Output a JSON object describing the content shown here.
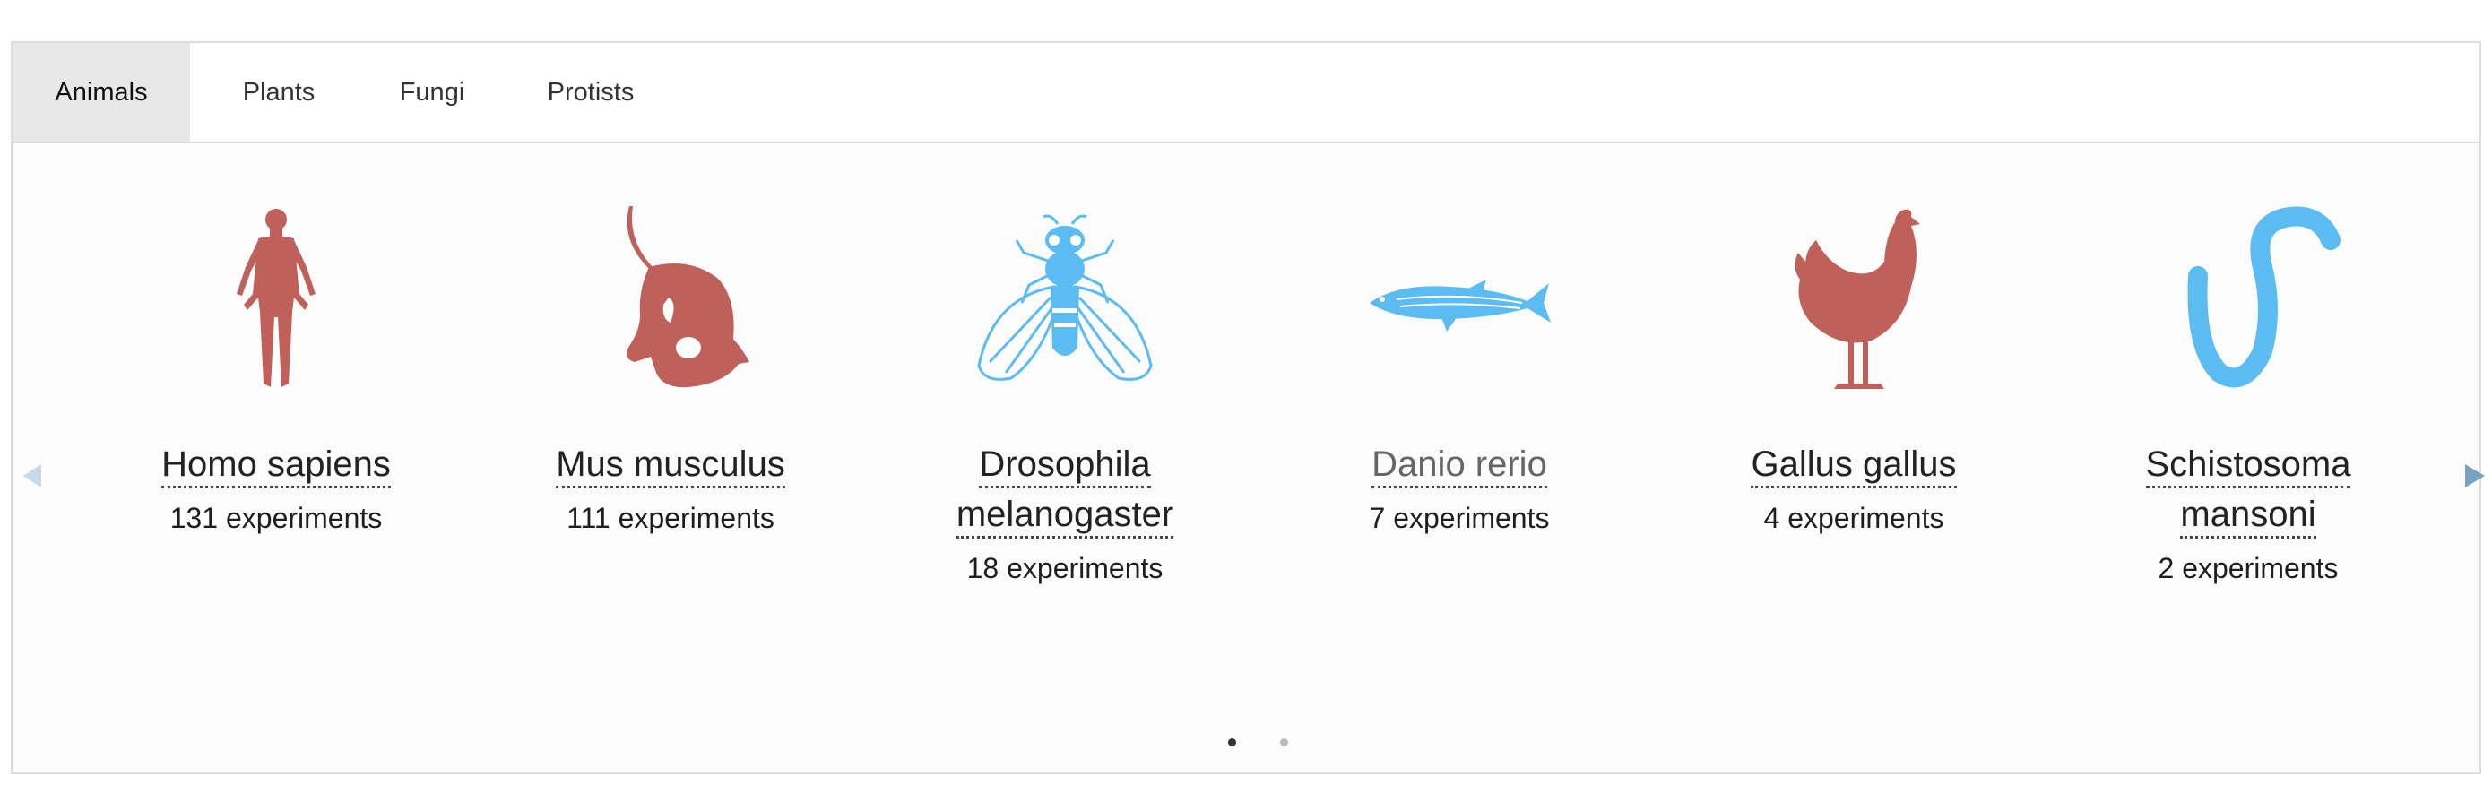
{
  "tabs": [
    {
      "label": "Animals",
      "active": true
    },
    {
      "label": "Plants",
      "active": false
    },
    {
      "label": "Fungi",
      "active": false
    },
    {
      "label": "Protists",
      "active": false
    }
  ],
  "species": [
    {
      "name_lines": [
        "Homo sapiens"
      ],
      "count": "131 experiments",
      "icon": "human-silhouette-icon",
      "color": "#c0605a"
    },
    {
      "name_lines": [
        "Mus musculus"
      ],
      "count": "111 experiments",
      "icon": "mouse-silhouette-icon",
      "color": "#c0605a"
    },
    {
      "name_lines": [
        "Drosophila",
        "melanogaster"
      ],
      "count": "18 experiments",
      "icon": "fly-icon",
      "color": "#5bbcf2"
    },
    {
      "name_lines": [
        "Danio rerio"
      ],
      "count": "7 experiments",
      "icon": "zebrafish-icon",
      "color": "#5bbcf2"
    },
    {
      "name_lines": [
        "Gallus gallus"
      ],
      "count": "4 experiments",
      "icon": "chicken-silhouette-icon",
      "color": "#c0605a"
    },
    {
      "name_lines": [
        "Schistosoma",
        "mansoni"
      ],
      "count": "2 experiments",
      "icon": "worm-icon",
      "color": "#5bbcf2"
    }
  ],
  "carousel": {
    "pages": 2,
    "current_page": 1
  },
  "colors": {
    "accent_red": "#c0605a",
    "accent_blue": "#5bbcf2",
    "arrow_blue": "#7aa3bf"
  }
}
